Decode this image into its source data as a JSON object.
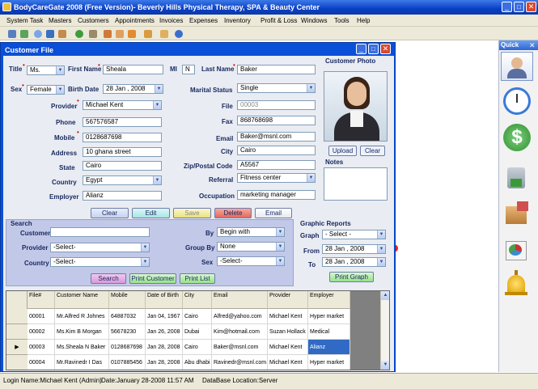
{
  "app": {
    "title": "BodyCareGate 2008 (Free Version)- Beverly Hills Physical Therapy, SPA & Beauty Center"
  },
  "menu": [
    "System Task",
    "Masters",
    "Customers",
    "Appointments",
    "Invoices",
    "Expenses",
    "Inventory",
    "Profit & Loss",
    "Windows",
    "Tools",
    "Help"
  ],
  "quick": {
    "title": "Quick"
  },
  "form": {
    "title": "Customer File",
    "labels": {
      "title": "Title",
      "first_name": "First Name",
      "mi": "MI",
      "last_name": "Last Name",
      "sex": "Sex",
      "birth_date": "Birth Date",
      "marital_status": "Marital Status",
      "provider": "Provider",
      "file": "File",
      "phone": "Phone",
      "fax": "Fax",
      "mobile": "Mobile",
      "email": "Email",
      "address": "Address",
      "city": "City",
      "state": "State",
      "zip": "Zip/Postal Code",
      "country": "Country",
      "referral": "Referral",
      "employer": "Employer",
      "occupation": "Occupation",
      "photo": "Customer Photo",
      "notes": "Notes"
    },
    "values": {
      "title": "Ms.",
      "first_name": "Sheala",
      "mi": "N",
      "last_name": "Baker",
      "sex": "Female",
      "birth_date": "28 Jan , 2008",
      "marital_status": "Single",
      "provider": "Michael Kent",
      "file": "00003",
      "phone": "567576587",
      "fax": "868768698",
      "mobile": "0128687698",
      "email": "Baker@msnl.com",
      "address": "10 ghana street",
      "city": "Cairo",
      "state": "Cairo",
      "zip": "A5567",
      "country": "Egypt",
      "referral": "Fitness center",
      "employer": "Alianz",
      "occupation": "marketing manager"
    },
    "photo_buttons": {
      "upload": "Upload",
      "clear": "Clear"
    },
    "buttons": {
      "clear": "Clear",
      "edit": "Edit",
      "save": "Save",
      "delete": "Delete",
      "email": "Email"
    }
  },
  "search": {
    "title": "Search",
    "labels": {
      "customer": "Customer",
      "provider": "Provider",
      "country": "Country",
      "by": "By",
      "group_by": "Group By",
      "sex": "Sex"
    },
    "values": {
      "customer": "",
      "provider": "-Select-",
      "country": "-Select-",
      "by": "Begin with",
      "group_by": "None",
      "sex": "-Select-"
    },
    "buttons": {
      "search": "Search",
      "print_customer": "Print Customer",
      "print_list": "Print List"
    }
  },
  "graphic": {
    "title": "Graphic Reports",
    "labels": {
      "graph": "Graph",
      "from": "From",
      "to": "To"
    },
    "values": {
      "graph": "- Select -",
      "from": "28 Jan , 2008",
      "to": "28 Jan , 2008"
    },
    "button": "Print Graph"
  },
  "table": {
    "columns": [
      "File#",
      "Customer Name",
      "Mobile",
      "Date of Birth",
      "City",
      "Email",
      "Provider",
      "Employer"
    ],
    "rows": [
      [
        "00001",
        "Mr.Alfred R Johnes",
        "64887032",
        "Jan 04, 1967",
        "Cairo",
        "Alfred@yahoo.com",
        "Michael Kent",
        "Hyper market"
      ],
      [
        "00002",
        "Ms.Kim B Morgan",
        "56678230",
        "Jan 26, 2008",
        "Dubai",
        "Kim@hotmail.com",
        "Suzan Hollack",
        "Medical"
      ],
      [
        "00003",
        "Ms.Sheala N Baker",
        "0128687698",
        "Jan 28, 2008",
        "Cairo",
        "Baker@msnl.com",
        "Michael Kent",
        "Alianz"
      ],
      [
        "00004",
        "Mr.Ravinedr I Das",
        "0107885456",
        "Jan 28, 2008",
        "Abu dhabi",
        "Ravinedr@msnl.com",
        "Michael Kent",
        "Hyper market"
      ]
    ]
  },
  "status": {
    "login": "Login Name:Michael Kent (Admin)",
    "date": "Date:January 28-2008  11:57 AM",
    "db": "DataBase Location:Server"
  }
}
